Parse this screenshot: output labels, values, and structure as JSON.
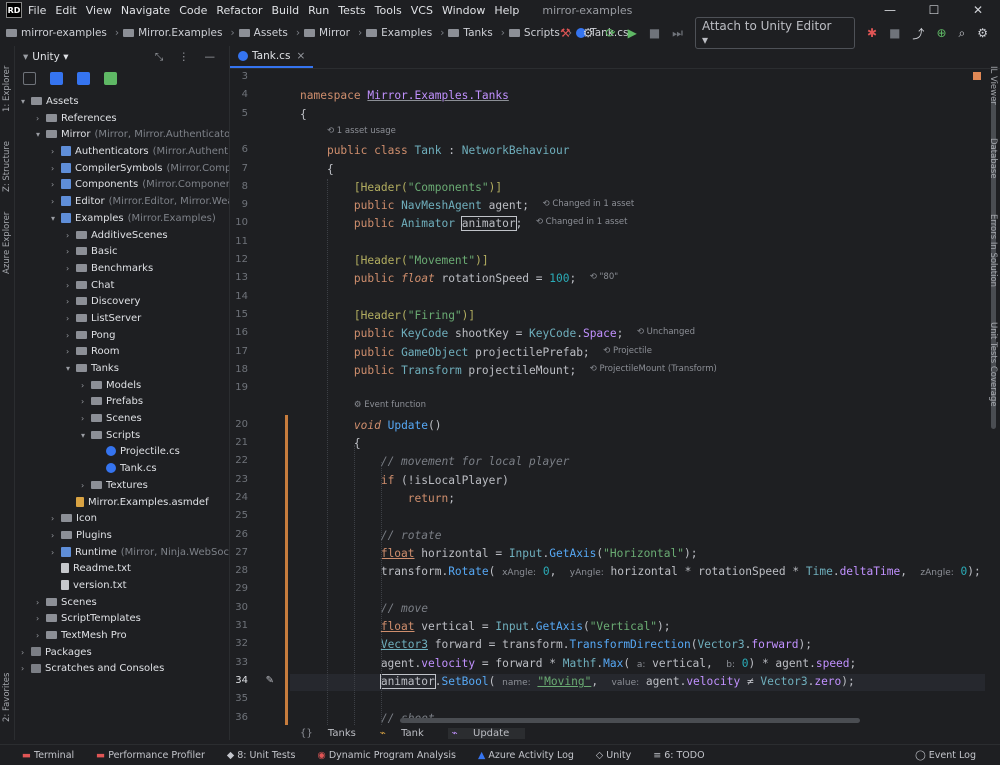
{
  "titlebar": {
    "menu": [
      "File",
      "Edit",
      "View",
      "Navigate",
      "Code",
      "Refactor",
      "Build",
      "Run",
      "Tests",
      "Tools",
      "VCS",
      "Window",
      "Help"
    ],
    "project_title": "mirror-examples",
    "window_controls": [
      "minimize-icon",
      "maximize-icon",
      "close-icon"
    ]
  },
  "navbar": {
    "breadcrumb": [
      "mirror-examples",
      "Mirror.Examples",
      "Assets",
      "Mirror",
      "Examples",
      "Tanks",
      "Scripts",
      "Tank.cs"
    ],
    "attach_label": "Attach to Unity Editor"
  },
  "left_strip": {
    "tools": [
      "1: Explorer",
      "Z: Structure",
      "Azure Explorer",
      "2: Favorites"
    ]
  },
  "right_strip": {
    "tools": [
      "IL Viewer",
      "Database",
      "Errors In Solution",
      "Unit Tests Coverage"
    ]
  },
  "project": {
    "selector": "Unity",
    "tree": [
      {
        "label": "Assets",
        "depth": 0,
        "open": true,
        "icon": "folder"
      },
      {
        "label": "References",
        "depth": 1,
        "open": false,
        "icon": "folder"
      },
      {
        "label": "Mirror",
        "sub": "(Mirror, Mirror.Authenticators,",
        "depth": 1,
        "open": true,
        "icon": "folder"
      },
      {
        "label": "Authenticators",
        "sub": "(Mirror.Authentica",
        "depth": 2,
        "open": false,
        "icon": "proj"
      },
      {
        "label": "CompilerSymbols",
        "sub": "(Mirror.Compile",
        "depth": 2,
        "open": false,
        "icon": "proj"
      },
      {
        "label": "Components",
        "sub": "(Mirror.Components",
        "depth": 2,
        "open": false,
        "icon": "proj"
      },
      {
        "label": "Editor",
        "sub": "(Mirror.Editor, Mirror.Weave",
        "depth": 2,
        "open": false,
        "icon": "proj"
      },
      {
        "label": "Examples",
        "sub": "(Mirror.Examples)",
        "depth": 2,
        "open": true,
        "icon": "proj"
      },
      {
        "label": "AdditiveScenes",
        "depth": 3,
        "open": false,
        "icon": "folder"
      },
      {
        "label": "Basic",
        "depth": 3,
        "open": false,
        "icon": "folder"
      },
      {
        "label": "Benchmarks",
        "depth": 3,
        "open": false,
        "icon": "folder"
      },
      {
        "label": "Chat",
        "depth": 3,
        "open": false,
        "icon": "folder"
      },
      {
        "label": "Discovery",
        "depth": 3,
        "open": false,
        "icon": "folder"
      },
      {
        "label": "ListServer",
        "depth": 3,
        "open": false,
        "icon": "folder"
      },
      {
        "label": "Pong",
        "depth": 3,
        "open": false,
        "icon": "folder"
      },
      {
        "label": "Room",
        "depth": 3,
        "open": false,
        "icon": "folder"
      },
      {
        "label": "Tanks",
        "depth": 3,
        "open": true,
        "icon": "folder"
      },
      {
        "label": "Models",
        "depth": 4,
        "open": false,
        "icon": "folder"
      },
      {
        "label": "Prefabs",
        "depth": 4,
        "open": false,
        "icon": "folder"
      },
      {
        "label": "Scenes",
        "depth": 4,
        "open": false,
        "icon": "folder"
      },
      {
        "label": "Scripts",
        "depth": 4,
        "open": true,
        "icon": "folder"
      },
      {
        "label": "Projectile.cs",
        "depth": 5,
        "leaf": true,
        "icon": "cs"
      },
      {
        "label": "Tank.cs",
        "depth": 5,
        "leaf": true,
        "icon": "cs"
      },
      {
        "label": "Textures",
        "depth": 4,
        "open": false,
        "icon": "folder"
      },
      {
        "label": "Mirror.Examples.asmdef",
        "depth": 3,
        "leaf": true,
        "icon": "asm"
      },
      {
        "label": "Icon",
        "depth": 2,
        "open": false,
        "icon": "folder"
      },
      {
        "label": "Plugins",
        "depth": 2,
        "open": false,
        "icon": "folder"
      },
      {
        "label": "Runtime",
        "sub": "(Mirror, Ninja.WebSocket",
        "depth": 2,
        "open": false,
        "icon": "proj"
      },
      {
        "label": "Readme.txt",
        "depth": 2,
        "leaf": true,
        "icon": "txt"
      },
      {
        "label": "version.txt",
        "depth": 2,
        "leaf": true,
        "icon": "txt"
      },
      {
        "label": "Scenes",
        "depth": 1,
        "open": false,
        "icon": "folder"
      },
      {
        "label": "ScriptTemplates",
        "depth": 1,
        "open": false,
        "icon": "folder"
      },
      {
        "label": "TextMesh Pro",
        "depth": 1,
        "open": false,
        "icon": "folder"
      },
      {
        "label": "Packages",
        "depth": 0,
        "open": false,
        "icon": "pkg"
      },
      {
        "label": "Scratches and Consoles",
        "depth": 0,
        "open": false,
        "icon": "pkg"
      }
    ]
  },
  "editor": {
    "tab": "Tank.cs",
    "current_line": 34,
    "lines": [
      {
        "n": "3",
        "html": ""
      },
      {
        "n": "4",
        "html": "<span class='kw'>namespace</span> <span class='ns'>Mirror.Examples.Tanks</span>"
      },
      {
        "n": "5",
        "html": "{"
      },
      {
        "n": "",
        "html": "    <span class='hint'>⟲ 1 asset usage</span>"
      },
      {
        "n": "6",
        "html": "    <span class='kw'>public class</span> <span class='cls'>Tank</span> : <span class='cls'>NetworkBehaviour</span>"
      },
      {
        "n": "7",
        "html": "    {"
      },
      {
        "n": "8",
        "html": "        <span class='an'>[Header(</span><span class='st'>\"Components\"</span><span class='an'>)]</span>"
      },
      {
        "n": "9",
        "html": "        <span class='kw'>public</span> <span class='cls'>NavMeshAgent</span> agent;  <span class='hint'>⟲ Changed in 1 asset</span>"
      },
      {
        "n": "10",
        "html": "        <span class='kw'>public</span> <span class='cls'>Animator</span> <span class='bx'>animator</span>;  <span class='hint'>⟲ Changed in 1 asset</span>"
      },
      {
        "n": "11",
        "html": ""
      },
      {
        "n": "12",
        "html": "        <span class='an'>[Header(</span><span class='st'>\"Movement\"</span><span class='an'>)]</span>"
      },
      {
        "n": "13",
        "html": "        <span class='kw'>public</span> <span class='kw' style='font-style:italic'>float</span> rotationSpeed = <span class='nu'>100</span>;  <span class='hint'>⟲ \"80\"</span>"
      },
      {
        "n": "14",
        "html": ""
      },
      {
        "n": "15",
        "html": "        <span class='an'>[Header(</span><span class='st'>\"Firing\"</span><span class='an'>)]</span>"
      },
      {
        "n": "16",
        "html": "        <span class='kw'>public</span> <span class='cls'>KeyCode</span> shootKey = <span class='cls'>KeyCode</span>.<span class='ty'>Space</span>;  <span class='hint'>⟲ Unchanged</span>"
      },
      {
        "n": "17",
        "html": "        <span class='kw'>public</span> <span class='cls'>GameObject</span> projectilePrefab;  <span class='hint'>⟲ Projectile</span>"
      },
      {
        "n": "18",
        "html": "        <span class='kw'>public</span> <span class='cls'>Transform</span> projectileMount;  <span class='hint'>⟲ ProjectileMount (Transform)</span>"
      },
      {
        "n": "19",
        "html": ""
      },
      {
        "n": "",
        "html": "        <span class='hint'>⚙ Event function</span>"
      },
      {
        "n": "20",
        "html": "        <span class='kw' style='font-style:italic'>void</span> <span class='fn'>Update</span>()"
      },
      {
        "n": "21",
        "html": "        {"
      },
      {
        "n": "22",
        "html": "            <span class='cm'>// movement for local player</span>"
      },
      {
        "n": "23",
        "html": "            <span class='kw'>if</span> (!isLocalPlayer)"
      },
      {
        "n": "24",
        "html": "                <span class='kw'>return</span>;"
      },
      {
        "n": "25",
        "html": ""
      },
      {
        "n": "26",
        "html": "            <span class='cm'>// rotate</span>"
      },
      {
        "n": "27",
        "html": "            <span class='kw' style='text-decoration:underline'>float</span> horizontal = <span class='cls'>Input</span>.<span class='fn'>GetAxis</span>(<span class='st'>\"Horizontal\"</span>);"
      },
      {
        "n": "28",
        "html": "            transform.<span class='fn'>Rotate</span>( <span class='ph'>xAngle:</span> <span class='nu'>0</span>,  <span class='ph'>yAngle:</span> horizontal * rotationSpeed * <span class='cls'>Time</span>.<span class='ty'>deltaTime</span>,  <span class='ph'>zAngle:</span> <span class='nu'>0</span>);"
      },
      {
        "n": "29",
        "html": ""
      },
      {
        "n": "30",
        "html": "            <span class='cm'>// move</span>"
      },
      {
        "n": "31",
        "html": "            <span class='kw' style='text-decoration:underline'>float</span> vertical = <span class='cls'>Input</span>.<span class='fn'>GetAxis</span>(<span class='st'>\"Vertical\"</span>);"
      },
      {
        "n": "32",
        "html": "            <span class='cls' style='text-decoration:underline'>Vector3</span> forward = transform.<span class='fn'>TransformDirection</span>(<span class='cls'>Vector3</span>.<span class='ty'>forward</span>);"
      },
      {
        "n": "33",
        "html": "            agent.<span class='ty'>velocity</span> = forward * <span class='cls'>Mathf</span>.<span class='fn'>Max</span>( <span class='ph'>a:</span> vertical,  <span class='ph'>b:</span> <span class='nu'>0</span>) * agent.<span class='ty'>speed</span>;"
      },
      {
        "n": "34",
        "html": "            <span class='bx'>animator</span>.<span class='fn'>SetBool</span>( <span class='ph'>name:</span> <span class='st' style='text-decoration:underline'>\"Moving\"</span>,  <span class='ph'>value:</span> agent.<span class='ty'>velocity</span> ≠ <span class='cls'>Vector3</span>.<span class='ty'>zero</span>);"
      },
      {
        "n": "35",
        "html": ""
      },
      {
        "n": "36",
        "html": "            <span class='cm'>// shoot</span>"
      }
    ]
  },
  "editor_breadcrumb": [
    "Tanks",
    "Tank",
    "Update"
  ],
  "statusbar": {
    "items": [
      "Terminal",
      "Performance Profiler",
      "8: Unit Tests",
      "Dynamic Program Analysis",
      "Azure Activity Log",
      "Unity",
      "6: TODO"
    ],
    "event_log": "Event Log"
  },
  "colors": {
    "background": "#1e1f22",
    "accent": "#3574f0",
    "keyword": "#cf8e6d",
    "string": "#6aab73",
    "number": "#2aacb8",
    "type": "#6fafbd",
    "attribute": "#b3ae60",
    "comment": "#7a7e85"
  }
}
